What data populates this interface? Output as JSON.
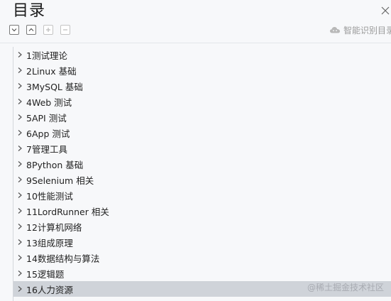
{
  "header": {
    "title": "目录",
    "ai_label": "智能识别目录"
  },
  "toc": {
    "items": [
      {
        "label": "1测试理论"
      },
      {
        "label": "2Linux  基础"
      },
      {
        "label": "3MySQL 基础"
      },
      {
        "label": "4Web 测试"
      },
      {
        "label": "5API  测试"
      },
      {
        "label": "6App  测试"
      },
      {
        "label": "7管理工具"
      },
      {
        "label": "8Python  基础"
      },
      {
        "label": "9Selenium  相关"
      },
      {
        "label": "10性能测试"
      },
      {
        "label": "11LordRunner 相关"
      },
      {
        "label": "12计算机网络"
      },
      {
        "label": "13组成原理"
      },
      {
        "label": "14数据结构与算法"
      },
      {
        "label": "15逻辑题"
      },
      {
        "label": "16人力资源"
      }
    ],
    "selected_index": 15
  },
  "watermark": "@稀土掘金技术社区",
  "colors": {
    "background": "#f7f8fa",
    "selected_row": "#cfd3d9",
    "muted_text": "#9a9a9a"
  }
}
